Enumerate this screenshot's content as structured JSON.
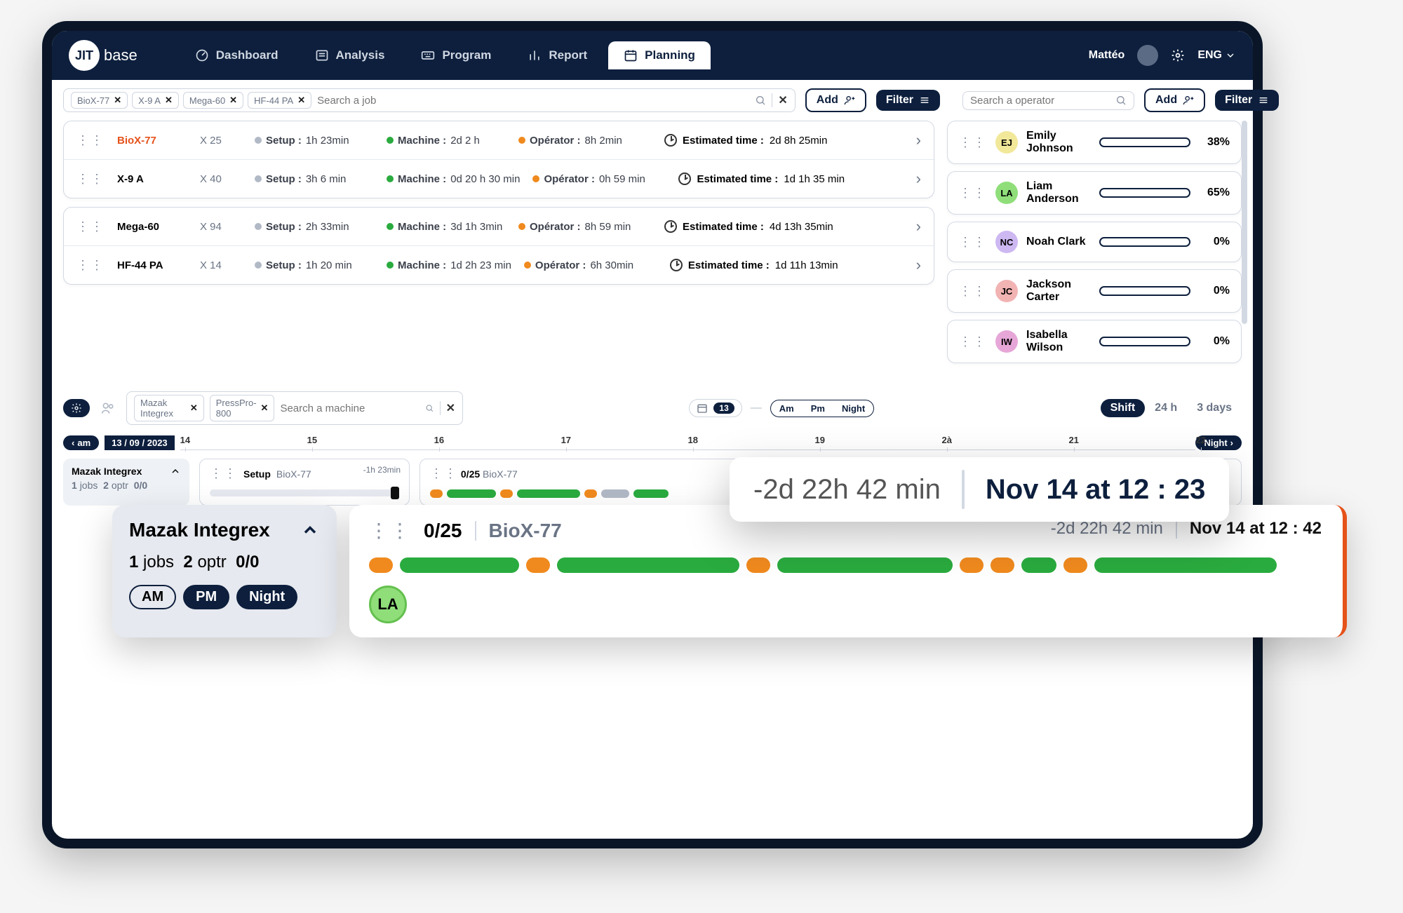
{
  "branding": {
    "logo_badge": "JIT",
    "logo_text": "base"
  },
  "nav": {
    "items": [
      {
        "label": "Dashboard"
      },
      {
        "label": "Analysis"
      },
      {
        "label": "Program"
      },
      {
        "label": "Report"
      },
      {
        "label": "Planning",
        "active": true
      }
    ],
    "user": "Mattéo",
    "lang": "ENG"
  },
  "jobs_toolbar": {
    "chips": [
      "BioX-77",
      "X-9 A",
      "Mega-60",
      "HF-44 PA"
    ],
    "search_placeholder": "Search a job",
    "add_label": "Add",
    "filter_label": "Filter"
  },
  "ops_toolbar": {
    "search_placeholder": "Search a operator",
    "add_label": "Add",
    "filter_label": "Filter"
  },
  "jobs": [
    {
      "name": "BioX-77",
      "accent": true,
      "qty": "X 25",
      "setup": "1h 23min",
      "machine": "2d 2 h",
      "operator": "8h 2min",
      "est": "2d 8h 25min"
    },
    {
      "name": "X-9 A",
      "qty": "X 40",
      "setup": "3h 6 min",
      "machine": "0d 20 h 30 min",
      "operator": "0h 59 min",
      "est": "1d 1h 35 min"
    },
    {
      "name": "Mega-60",
      "qty": "X 94",
      "setup": "2h  33min",
      "machine": "3d 1h 3min",
      "operator": "8h 59 min",
      "est": "4d 13h 35min"
    },
    {
      "name": "HF-44 PA",
      "qty": "X 14",
      "setup": "1h 20 min",
      "machine": "1d 2h 23 min",
      "operator": "6h 30min",
      "est": "1d 11h 13min"
    }
  ],
  "labels": {
    "setup": "Setup :",
    "machine": "Machine :",
    "operator": "Opérator :",
    "estimated": "Estimated time :"
  },
  "operators": [
    {
      "initials": "EJ",
      "name": "Emily Johnson",
      "pct": 38,
      "color": "#f2e89a"
    },
    {
      "initials": "LA",
      "name": "Liam Anderson",
      "pct": 65,
      "color": "#8fde7a"
    },
    {
      "initials": "NC",
      "name": "Noah Clark",
      "pct": 0,
      "color": "#cdb8f2"
    },
    {
      "initials": "JC",
      "name": "Jackson Carter",
      "pct": 0,
      "color": "#f2b3b3"
    },
    {
      "initials": "IW",
      "name": "Isabella Wilson",
      "pct": 0,
      "color": "#e6a7d8"
    }
  ],
  "timeline_toolbar": {
    "machine_chips": [
      "Mazak Integrex",
      "PressPro-800"
    ],
    "search_placeholder": "Search a machine",
    "date_badge": "13",
    "ampm": {
      "am": "Am",
      "pm": "Pm",
      "night": "Night"
    },
    "view": {
      "shift": "Shift",
      "day": "24 h",
      "threeday": "3 days"
    }
  },
  "axis": {
    "left_btn": "am",
    "date": "13 / 09 / 2023",
    "hours": [
      "14",
      "15",
      "16",
      "17",
      "18",
      "19",
      "2à",
      "21",
      "22"
    ],
    "right_btn": "Night"
  },
  "lane": {
    "machine": "Mazak Integrex",
    "jobs_count": "1",
    "jobs_label": "jobs",
    "optr_count": "2",
    "optr_label": "optr",
    "ratio": "0/0",
    "setup": {
      "label": "Setup",
      "job": "BioX-77",
      "eta": "-1h 23min"
    },
    "progress": {
      "count": "0/25",
      "job": "BioX-77"
    }
  },
  "float": {
    "delta": "-2d 22h  42 min",
    "deadline": "Nov 14 at 12 : 23"
  },
  "detail": {
    "machine": "Mazak Integrex",
    "jobs_count": "1",
    "jobs_label": "jobs",
    "optr_count": "2",
    "optr_label": "optr",
    "ratio": "0/0",
    "shifts": {
      "am": "AM",
      "pm": "PM",
      "night": "Night"
    },
    "hdr_count": "0/25",
    "hdr_job": "BioX-77",
    "delta": "-2d 22h  42 min",
    "deadline": "Nov 14 at 12 : 42",
    "operator_initials": "LA"
  }
}
